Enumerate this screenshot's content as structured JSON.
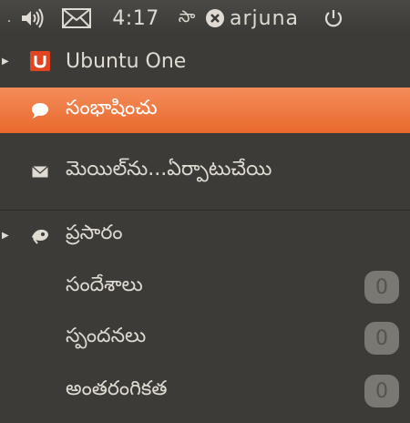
{
  "panel": {
    "clock": "4:17",
    "language": "సా",
    "user": "arjuna",
    "icons": [
      "volume-icon",
      "mail-icon",
      "user-status-icon",
      "power-icon"
    ]
  },
  "menu": {
    "app": {
      "label": "Ubuntu One",
      "icon": "ubuntu-one-icon",
      "brand_color": "#e0451f"
    },
    "chat": {
      "label": "సంభాషించు",
      "icon": "chat-bubble-icon",
      "highlight_color": "#f07a40"
    },
    "mail_setup": {
      "label": "మెయిల్‌ను...ఏర్పాటుచేయి",
      "icon": "envelope-icon"
    },
    "broadcast": {
      "label": "ప్రసారం",
      "icon": "gwibber-icon"
    },
    "messages": {
      "label": "సందేశాలు",
      "count": "0"
    },
    "replies": {
      "label": "స్పందనలు",
      "count": "0"
    },
    "private": {
      "label": "అంతరంగికత",
      "count": "0"
    }
  }
}
